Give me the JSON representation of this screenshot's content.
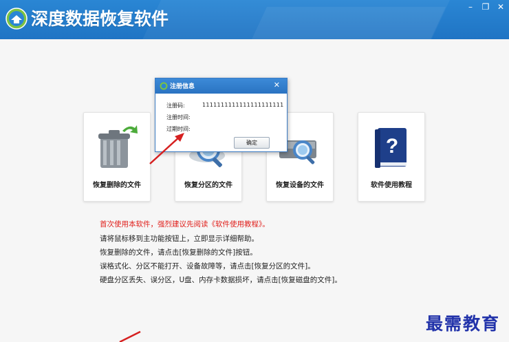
{
  "app": {
    "title": "深度数据恢复软件",
    "controls": {
      "minimize": "–",
      "restore": "❐",
      "close": "✕"
    }
  },
  "cards": [
    {
      "id": "recover-deleted",
      "label": "恢复删除的文件",
      "icon": "trash-recycle-icon"
    },
    {
      "id": "recover-partition",
      "label": "恢复分区的文件",
      "icon": "partition-search-icon"
    },
    {
      "id": "recover-device",
      "label": "恢复设备的文件",
      "icon": "device-search-icon"
    },
    {
      "id": "tutorial",
      "label": "软件使用教程",
      "icon": "help-book-icon"
    }
  ],
  "dialog": {
    "title": "注册信息",
    "close": "✕",
    "fields": [
      {
        "label": "注册码:",
        "value": "1111111111111111111111"
      },
      {
        "label": "注册时间:",
        "value": ""
      },
      {
        "label": "过期时间:",
        "value": ""
      }
    ],
    "ok_label": "确定"
  },
  "info_lines": [
    {
      "text": "首次使用本软件，强烈建议先阅读《软件使用教程》。",
      "color": "#e0201c"
    },
    {
      "text": "请将鼠标移到主功能按钮上，立即显示详细帮助。",
      "color": "#222222"
    },
    {
      "text": "恢复删除的文件，请点击[恢复删除的文件]按钮。",
      "color": "#222222"
    },
    {
      "text": "误格式化、分区不能打开、设备故障等，请点击[恢复分区的文件]。",
      "color": "#222222"
    },
    {
      "text": "硬盘分区丢失、误分区，U盘、内存卡数据损坏，请点击[恢复磁盘的文件]。",
      "color": "#222222"
    }
  ],
  "watermark": "最需教育",
  "colors": {
    "titlebar": "#2a7fcf",
    "accent": "#e0201c",
    "watermark": "#2233aa"
  }
}
